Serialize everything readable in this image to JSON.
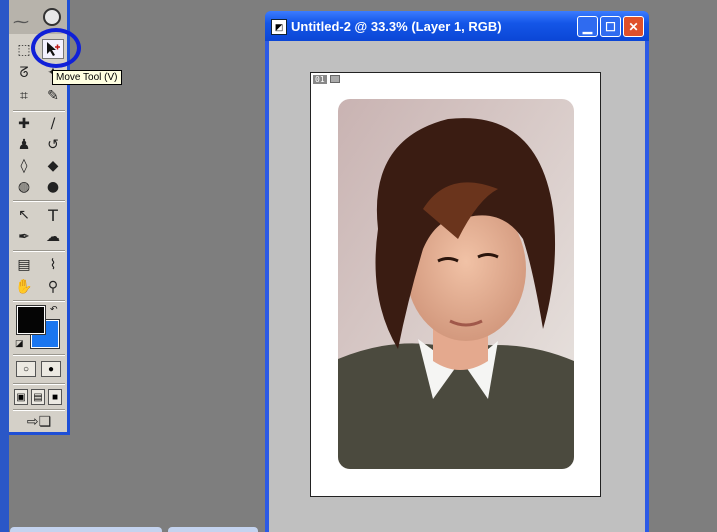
{
  "tooltip": {
    "text": "Move Tool (V)"
  },
  "document": {
    "title": "Untitled-2 @ 33.3% (Layer 1, RGB)",
    "slice_label": "01"
  },
  "toolbox": {
    "tools": [
      {
        "name": "marquee-tool-icon",
        "glyph": "⬚"
      },
      {
        "name": "move-tool-icon",
        "glyph": "➤"
      },
      {
        "name": "lasso-tool-icon",
        "glyph": "ᘔ"
      },
      {
        "name": "magic-wand-tool-icon",
        "glyph": "✦"
      },
      {
        "name": "crop-tool-icon",
        "glyph": "⌗"
      },
      {
        "name": "slice-tool-icon",
        "glyph": "✎"
      },
      {
        "name": "healing-brush-tool-icon",
        "glyph": "✚"
      },
      {
        "name": "brush-tool-icon",
        "glyph": "🖌"
      },
      {
        "name": "clone-stamp-tool-icon",
        "glyph": "♟"
      },
      {
        "name": "history-brush-tool-icon",
        "glyph": "↺"
      },
      {
        "name": "eraser-tool-icon",
        "glyph": "◊"
      },
      {
        "name": "paint-bucket-tool-icon",
        "glyph": "◆"
      },
      {
        "name": "blur-tool-icon",
        "glyph": "◍"
      },
      {
        "name": "dodge-tool-icon",
        "glyph": "●"
      },
      {
        "name": "path-selection-tool-icon",
        "glyph": "↖"
      },
      {
        "name": "type-tool-icon",
        "glyph": "T"
      },
      {
        "name": "pen-tool-icon",
        "glyph": "✒"
      },
      {
        "name": "custom-shape-tool-icon",
        "glyph": "☁"
      },
      {
        "name": "notes-tool-icon",
        "glyph": "▤"
      },
      {
        "name": "eyedropper-tool-icon",
        "glyph": "⌇"
      },
      {
        "name": "hand-tool-icon",
        "glyph": "✋"
      },
      {
        "name": "zoom-tool-icon",
        "glyph": "🔍"
      }
    ]
  },
  "colors": {
    "foreground": "#050505",
    "background": "#1a76f0"
  }
}
